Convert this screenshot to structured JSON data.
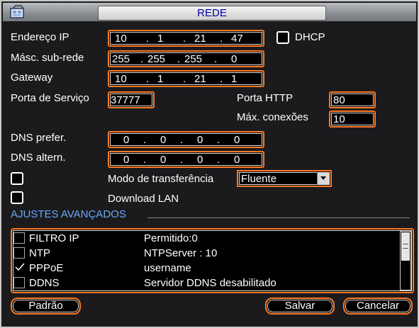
{
  "window": {
    "title": "REDE"
  },
  "fields": {
    "ip_label": "Endereço IP",
    "ip": [
      "10",
      "1",
      "21",
      "47"
    ],
    "dhcp_label": "DHCP",
    "mask_label": "Másc. sub-rede",
    "mask": [
      "255",
      "255",
      "255",
      "0"
    ],
    "gateway_label": "Gateway",
    "gateway": [
      "10",
      "1",
      "21",
      "1"
    ],
    "service_port_label": "Porta de Serviço",
    "service_port": "37777",
    "http_port_label": "Porta HTTP",
    "http_port": "80",
    "max_conn_label": "Máx. conexões",
    "max_conn": "10",
    "dns_pref_label": "DNS prefer.",
    "dns_pref": [
      "0",
      "0",
      "0",
      "0"
    ],
    "dns_alt_label": "DNS altern.",
    "dns_alt": [
      "0",
      "0",
      "0",
      "0"
    ],
    "transfer_mode_label": "Modo de transferência",
    "transfer_mode": "Fluente",
    "download_lan_label": "Download LAN"
  },
  "advanced": {
    "title": "AJUSTES AVANÇADOS",
    "rows": [
      {
        "name": "FILTRO IP",
        "desc": "Permitido:0",
        "checked": false
      },
      {
        "name": "NTP",
        "desc": "NTPServer : 10",
        "checked": false
      },
      {
        "name": "PPPoE",
        "desc": "username",
        "checked": true
      },
      {
        "name": "DDNS",
        "desc": "Servidor DDNS desabilitado",
        "checked": false
      }
    ]
  },
  "buttons": {
    "default": "Padrão",
    "save": "Salvar",
    "cancel": "Cancelar"
  },
  "colors": {
    "accent": "#ff7a22",
    "title_text": "#0000a8",
    "section": "#6aa8ff"
  },
  "icons": {
    "app": "network-settings-icon",
    "dropdown": "triangle-down-icon"
  }
}
